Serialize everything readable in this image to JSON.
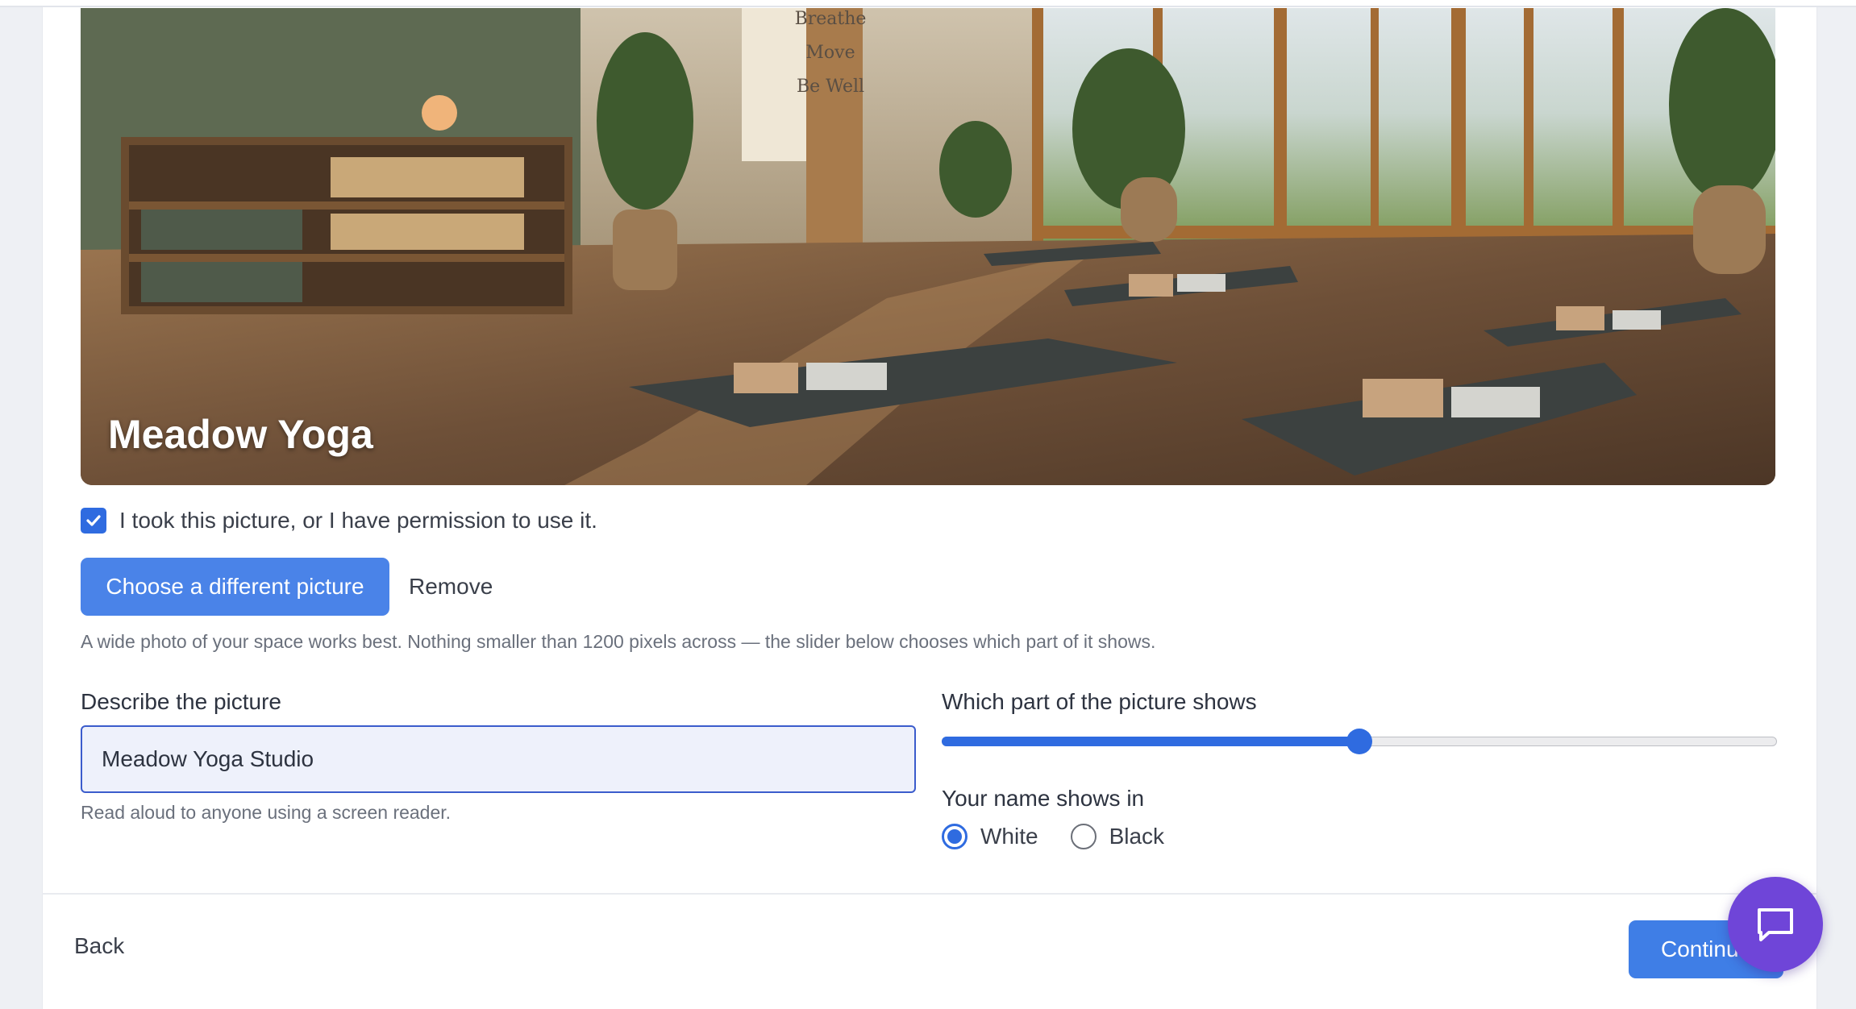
{
  "hero": {
    "title": "Meadow Yoga",
    "image": "yoga studio with mats, plants, shelves and large windows",
    "poster_lines": [
      "Breathe",
      "Move",
      "Be Well"
    ]
  },
  "permission": {
    "checked": true,
    "label": "I took this picture, or I have permission to use it."
  },
  "actions": {
    "choose_label": "Choose a different picture",
    "remove_label": "Remove",
    "hint": "A wide photo of your space works best. Nothing smaller than 1200 pixels across — the slider below chooses which part of it shows."
  },
  "describe": {
    "label": "Describe the picture",
    "value": "Meadow Yoga Studio",
    "help": "Read aloud to anyone using a screen reader."
  },
  "position": {
    "label": "Which part of the picture shows",
    "value": 0.5
  },
  "name_color": {
    "label": "Your name shows in",
    "options": [
      {
        "label": "White",
        "selected": true
      },
      {
        "label": "Black",
        "selected": false
      }
    ]
  },
  "footer": {
    "back_label": "Back",
    "continue_label": "Continue"
  },
  "chat": {
    "icon": "chat-bubble-icon"
  },
  "colors": {
    "accent": "#2f6be0",
    "button": "#4a83e8",
    "chat": "#6f45d8"
  }
}
